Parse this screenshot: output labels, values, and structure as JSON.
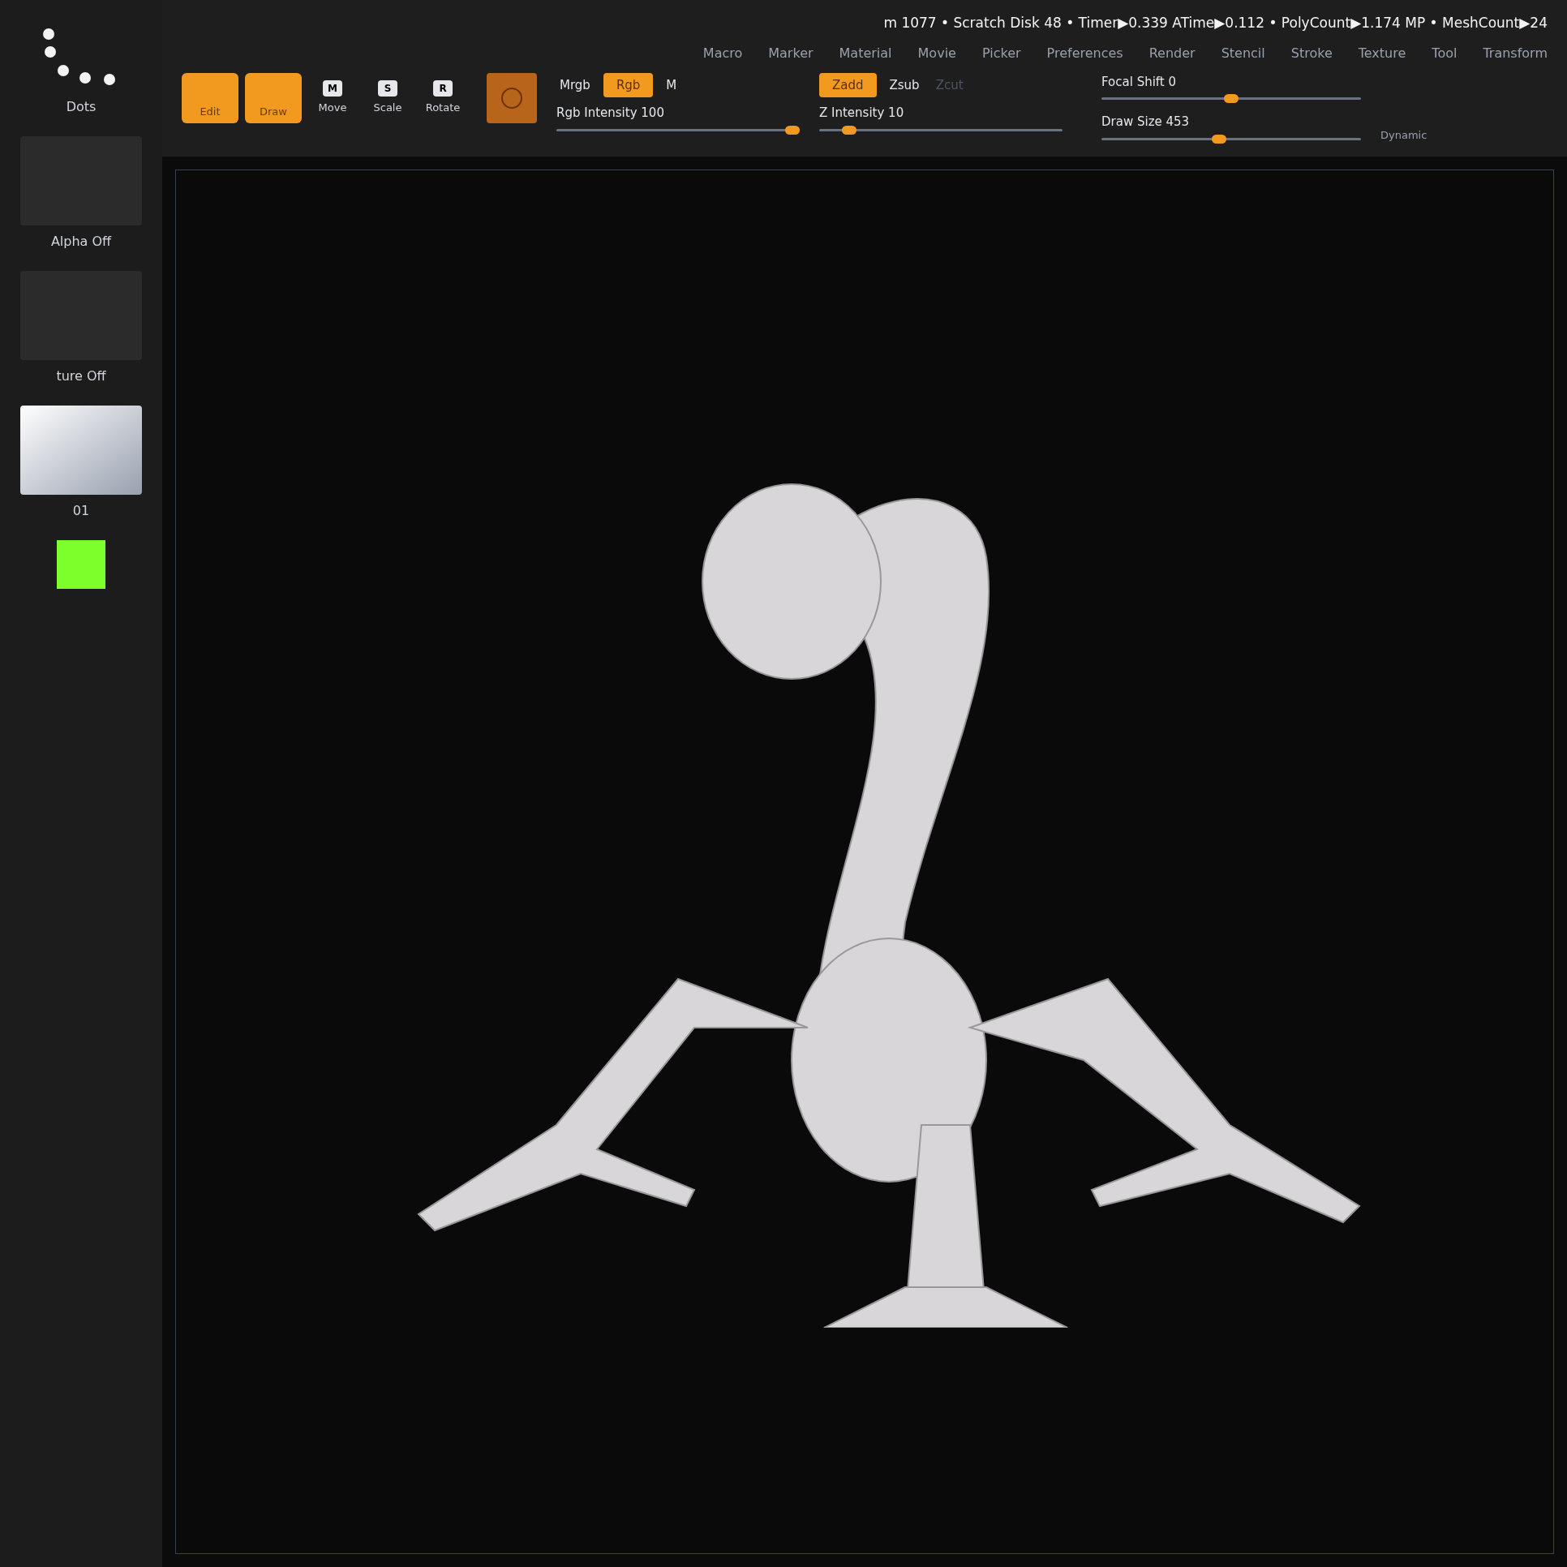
{
  "status_bar": {
    "text": "m 1077 • Scratch Disk 48 • Timer▶0.339 ATime▶0.112 • PolyCount▶1.174 MP • MeshCount▶24"
  },
  "menu": [
    "Macro",
    "Marker",
    "Material",
    "Movie",
    "Picker",
    "Preferences",
    "Render",
    "Stencil",
    "Stroke",
    "Texture",
    "Tool",
    "Transform"
  ],
  "tools": [
    {
      "label": "Edit",
      "kind": "big",
      "selected": true
    },
    {
      "label": "Draw",
      "kind": "big",
      "selected": true
    },
    {
      "label": "Move",
      "key": "M",
      "kind": "small",
      "selected": false
    },
    {
      "label": "Scale",
      "key": "S",
      "kind": "small",
      "selected": false
    },
    {
      "label": "Rotate",
      "key": "R",
      "kind": "small",
      "selected": false
    }
  ],
  "rgb_group": {
    "toggles": [
      {
        "label": "Mrgb",
        "on": false
      },
      {
        "label": "Rgb",
        "on": true
      },
      {
        "label": "M",
        "on": false
      }
    ],
    "slider": {
      "label": "Rgb Intensity 100",
      "level": 1
    }
  },
  "z_group": {
    "toggles": [
      {
        "label": "Zadd",
        "on": true,
        "disabled": false
      },
      {
        "label": "Zsub",
        "on": false,
        "disabled": false
      },
      {
        "label": "Zcut",
        "on": false,
        "disabled": true
      }
    ],
    "slider": {
      "label": "Z Intensity 10",
      "level": 0.1
    }
  },
  "brush_sliders": [
    {
      "label": "Focal Shift 0",
      "level": 0.5
    },
    {
      "label": "Draw Size 453",
      "level": 0.45
    }
  ],
  "dynamic_label": "Dynamic",
  "left_shelf": [
    {
      "label": "Dots",
      "kind": "stroke"
    },
    {
      "label": "Alpha Off",
      "kind": "empty"
    },
    {
      "label": "ture Off",
      "kind": "empty"
    },
    {
      "label": "01",
      "kind": "material"
    }
  ]
}
